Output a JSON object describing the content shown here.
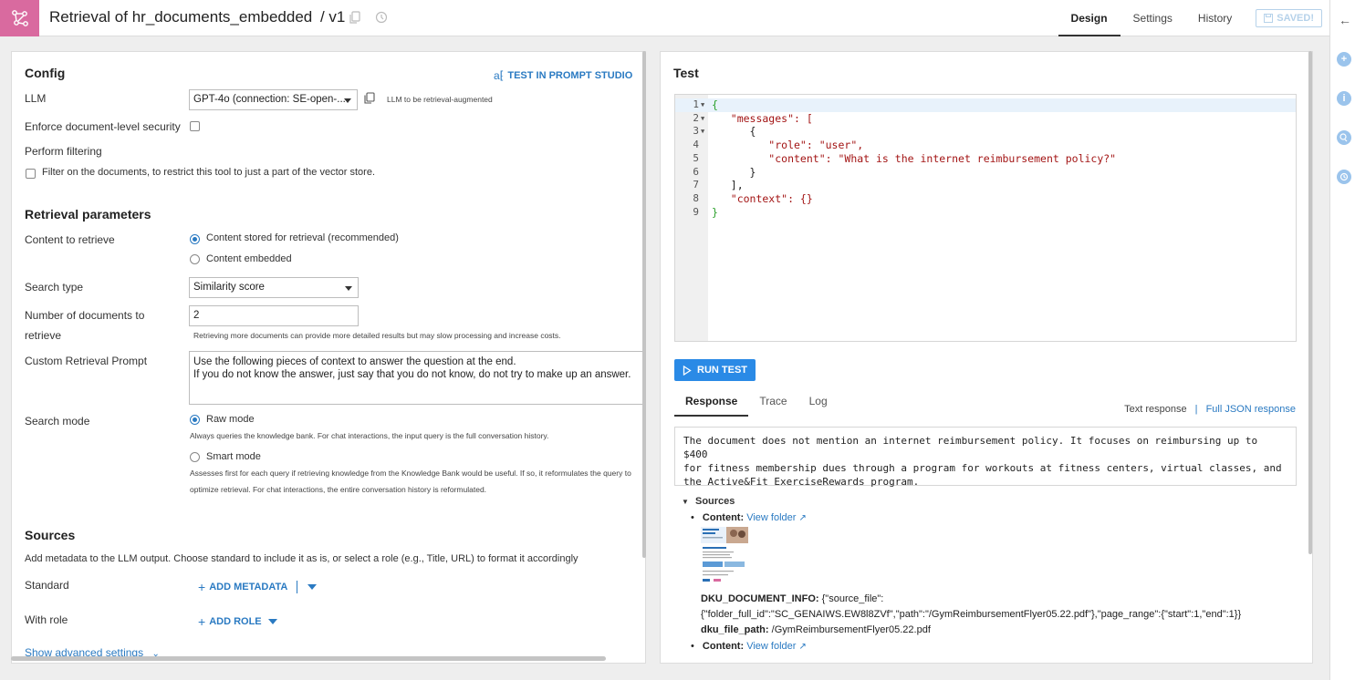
{
  "header": {
    "title": "Retrieval of hr_documents_embedded",
    "version": "/ v1",
    "tabs": [
      {
        "label": "Design",
        "active": true
      },
      {
        "label": "Settings",
        "active": false
      },
      {
        "label": "History",
        "active": false
      }
    ],
    "saved_label": "SAVED!",
    "accent_color": "#d96a9f"
  },
  "config": {
    "title": "Config",
    "test_prompt_studio": "TEST IN PROMPT STUDIO",
    "llm_label": "LLM",
    "llm_value": "GPT-4o (connection: SE-open-...",
    "llm_hint": "LLM to be retrieval-augmented",
    "enforce_label": "Enforce document-level security",
    "filtering_label": "Perform filtering",
    "filter_checkbox_label": "Filter on the documents, to restrict this tool to just a part of the vector store."
  },
  "retrieval": {
    "title": "Retrieval parameters",
    "content_label": "Content to retrieve",
    "content_options": [
      "Content stored for retrieval (recommended)",
      "Content embedded"
    ],
    "search_type_label": "Search type",
    "search_type_value": "Similarity score",
    "num_docs_label_1": "Number of documents to",
    "num_docs_label_2": "retrieve",
    "num_docs_value": "2",
    "num_docs_hint": "Retrieving more documents can provide more detailed results but may slow processing and increase costs.",
    "prompt_label": "Custom Retrieval Prompt",
    "prompt_line_1": "Use the following pieces of context to answer the question at the end.",
    "prompt_line_2": "If you do not know the answer, just say that you do not know, do not try to make up an answer.",
    "search_mode_label": "Search mode",
    "raw_mode_label": "Raw mode",
    "raw_mode_hint": "Always queries the knowledge bank. For chat interactions, the input query is the full conversation history.",
    "smart_mode_label": "Smart mode",
    "smart_mode_hint_1": "Assesses first for each query if retrieving knowledge from the Knowledge Bank would be useful. If so, it reformulates the query to",
    "smart_mode_hint_2": "optimize retrieval. For chat interactions, the entire conversation history is reformulated."
  },
  "sources": {
    "title": "Sources",
    "description": "Add metadata to the LLM output. Choose standard to include it as is, or select a role (e.g., Title, URL) to format it accordingly",
    "standard_label": "Standard",
    "add_metadata": "ADD METADATA",
    "with_role_label": "With role",
    "add_role": "ADD ROLE",
    "advanced": "Show advanced settings"
  },
  "test": {
    "title": "Test",
    "code_lines": [
      "{",
      "   \"messages\": [",
      "      {",
      "         \"role\": \"user\",",
      "         \"content\": \"What is the internet reimbursement policy?\"",
      "      }",
      "   ],",
      "   \"context\": {}",
      "}"
    ],
    "run_test": "RUN TEST",
    "tabs": [
      "Response",
      "Trace",
      "Log"
    ],
    "text_response": "Text response",
    "separator": "|",
    "full_json": "Full JSON response",
    "response_lines": [
      "The document does not mention an internet reimbursement policy. It focuses on reimbursing up to $400",
      "for fitness membership dues through a program for workouts at fitness centers, virtual classes, and",
      "the Active&Fit ExerciseRewards program."
    ],
    "sources_title": "Sources",
    "content_label": "Content:",
    "view_folder": "View folder",
    "doc_info_label": "DKU_DOCUMENT_INFO:",
    "doc_info_value_1": "{\"source_file\":",
    "doc_info_value_2": "{\"folder_full_id\":\"SC_GENAIWS.EW8l8ZVf\",\"path\":\"/GymReimbursementFlyer05.22.pdf\"},\"page_range\":{\"start\":1,\"end\":1}}",
    "file_path_label": "dku_file_path:",
    "file_path_value": "/GymReimbursementFlyer05.22.pdf"
  }
}
